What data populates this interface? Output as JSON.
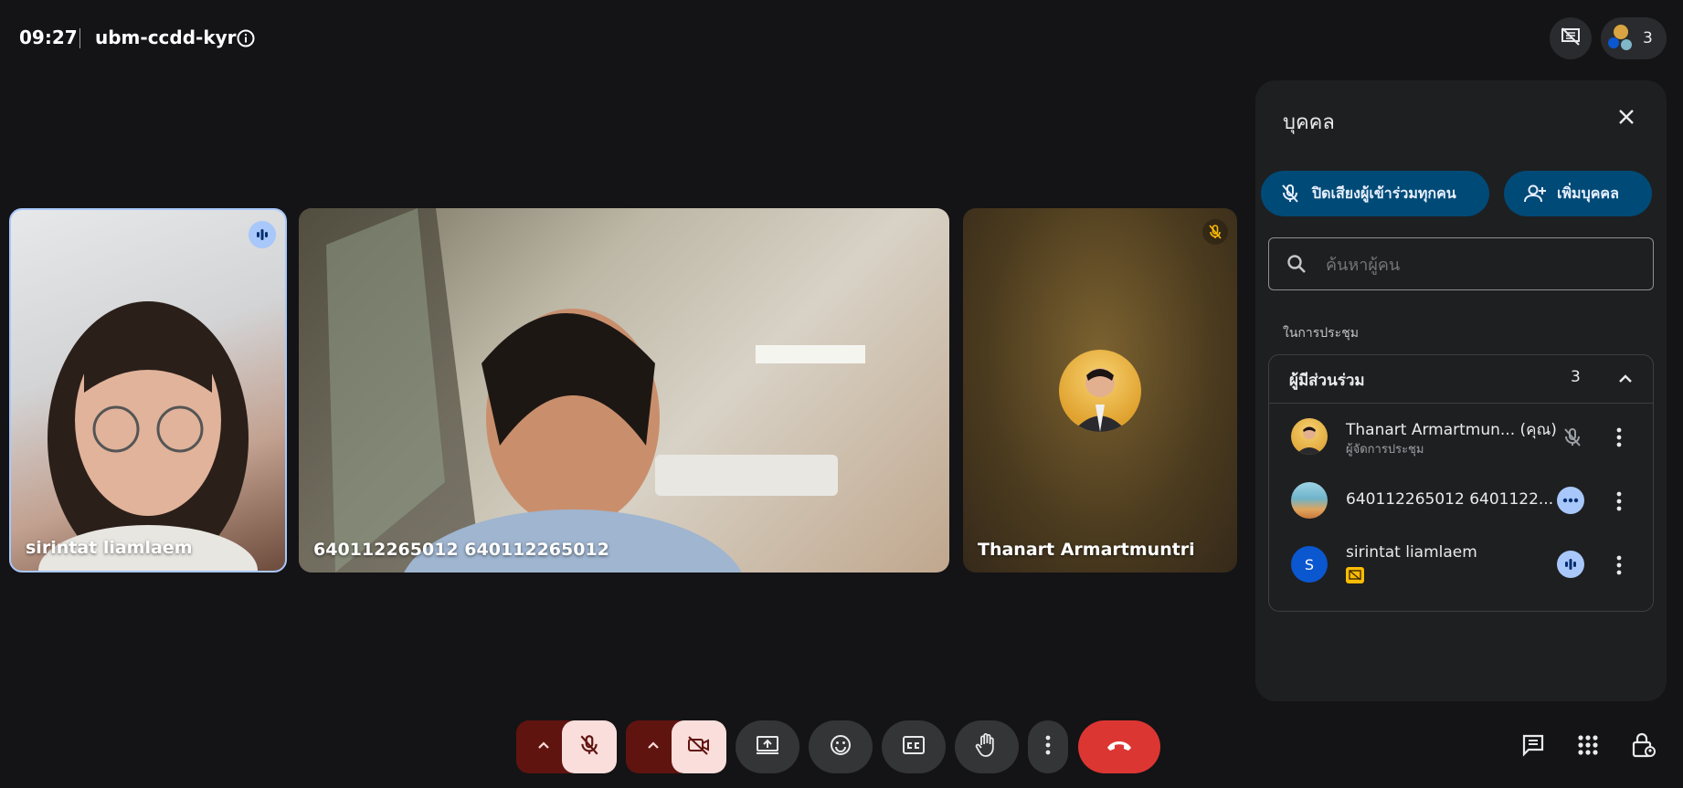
{
  "header": {
    "time": "09:27",
    "meeting_code": "ubm-ccdd-kyr",
    "participant_count": "3",
    "info_icon": "info-icon",
    "presentation_icon": "presentation-off-icon"
  },
  "tiles": [
    {
      "name": "sirintat liamlaem",
      "status_icon": "speaking-icon"
    },
    {
      "name": "640112265012 640112265012"
    },
    {
      "name": "Thanart Armartmuntri",
      "status_icon": "mic-off-icon"
    }
  ],
  "panel": {
    "title": "บุคคล",
    "mute_all_label": "ปิดเสียงผู้เข้าร่วมทุกคน",
    "add_people_label": "เพิ่มบุคคล",
    "search_placeholder": "ค้นหาผู้คน",
    "section_label": "ในการประชุม",
    "group_label": "ผู้มีส่วนร่วม",
    "group_count": "3",
    "participants": [
      {
        "name": "Thanart Armartmun... (คุณ)",
        "role": "ผู้จัดการประชุม",
        "status": "mic-off"
      },
      {
        "name": "640112265012 6401122...",
        "status": "more-options"
      },
      {
        "name": "sirintat liamlaem",
        "avatar_letter": "S",
        "status": "speaking",
        "badge": "presentation-badge-icon"
      }
    ]
  },
  "controls": {
    "mic": "mic-off",
    "camera": "camera-off",
    "buttons": [
      "present-screen",
      "emoji",
      "captions",
      "raise-hand",
      "more-options",
      "leave-call"
    ]
  },
  "colors": {
    "background": "#141416",
    "panel": "#1e1f20",
    "accent_pill": "#004a77",
    "leave_red": "#dc3633",
    "speaking_blue": "#a8c7fa"
  }
}
